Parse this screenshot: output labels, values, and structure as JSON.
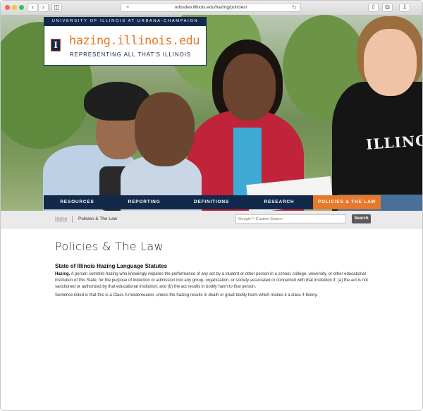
{
  "browser": {
    "url": "odosdev.illinois.edu/hazing/policies/",
    "icons": {
      "back": "chevron-left-icon",
      "forward": "chevron-right-icon",
      "sidebar": "sidebar-icon",
      "share": "share-icon",
      "tabs": "tabs-icon",
      "download": "download-icon",
      "reload": "reload-icon"
    }
  },
  "header": {
    "university_bar": "UNIVERSITY OF ILLINOIS AT URBANA-CHAMPAIGN",
    "block_i": "I",
    "site_title": "hazing.illinois.edu",
    "tagline": "REPRESENTING ALL THAT'S ILLINOIS",
    "hero_shirt_text": "ILLINOIS"
  },
  "nav": {
    "items": [
      {
        "label": "RESOURCES"
      },
      {
        "label": "REPORTING"
      },
      {
        "label": "DEFINITIONS"
      },
      {
        "label": "RESEARCH"
      },
      {
        "label": "POLICIES & THE LAW"
      }
    ],
    "active_index": 4
  },
  "breadcrumb": {
    "home": "Home",
    "current": "Policies & The Law"
  },
  "search": {
    "placeholder": "Google™ Custom Search",
    "button": "Search"
  },
  "content": {
    "title": "Policies & The Law",
    "section_heading": "State of Illinois Hazing Language Statutes",
    "para1_lead": "Hazing.",
    "para1_text": " A person commits hazing who knowingly requires the performance of any act by a student or other person in a school, college, university, or other educational institution of this State, for the purpose of induction or admission into any group, organization, or society associated or connected with that institution if; (a) the act is not sanctioned or authorized by that educational institution; and (b) the act results in bodily harm to that person.",
    "para2": "Sentence listed is that this is a Class A misdemeanor, unless the hazing results in death or great bodily harm which makes it a class 4 felony."
  },
  "colors": {
    "navy": "#13294b",
    "orange": "#e8782a",
    "grey_bar": "#eaeaea"
  }
}
